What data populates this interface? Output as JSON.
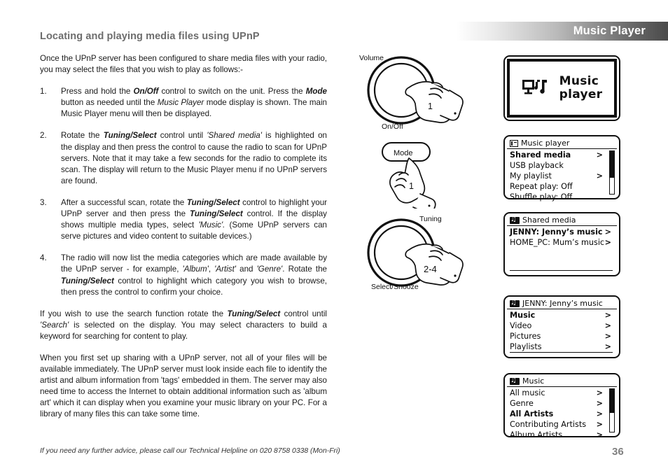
{
  "header": {
    "title": "Music Player"
  },
  "page": {
    "heading": "Locating and playing media files using UPnP",
    "number": "36",
    "footer_note": "If you need any further advice, please call our Technical Helpline on 020 8758 0338 (Mon-Fri)"
  },
  "intro": "Once the UPnP server has been configured to share media files with your radio, you may select the files that you wish to play as follows:-",
  "steps": [
    {
      "num": "1.",
      "text_parts": [
        {
          "t": "Press and hold the ",
          "s": "n"
        },
        {
          "t": "On/Off",
          "s": "bi"
        },
        {
          "t": " control to switch on the unit. Press the ",
          "s": "n"
        },
        {
          "t": "Mode",
          "s": "bi"
        },
        {
          "t": " button as needed until the ",
          "s": "n"
        },
        {
          "t": "Music Player",
          "s": "i"
        },
        {
          "t": " mode display is shown. The main Music Player menu will then be displayed.",
          "s": "n"
        }
      ]
    },
    {
      "num": "2.",
      "text_parts": [
        {
          "t": "Rotate the ",
          "s": "n"
        },
        {
          "t": "Tuning/Select",
          "s": "bi"
        },
        {
          "t": " control until ",
          "s": "n"
        },
        {
          "t": "'Shared media'",
          "s": "i"
        },
        {
          "t": " is highlighted on the display and then press the control to cause the radio to scan for UPnP servers. Note that it may take a few seconds for the radio to complete its scan. The display will return to the Music Player menu if no UPnP servers are found.",
          "s": "n"
        }
      ]
    },
    {
      "num": "3.",
      "text_parts": [
        {
          "t": "After a successful scan, rotate the ",
          "s": "n"
        },
        {
          "t": "Tuning/Select",
          "s": "bi"
        },
        {
          "t": " control to highlight your UPnP server and then press the ",
          "s": "n"
        },
        {
          "t": "Tuning/Select",
          "s": "bi"
        },
        {
          "t": " control. If the display shows multiple media types, select ",
          "s": "n"
        },
        {
          "t": "'Music'.",
          "s": "i"
        },
        {
          "t": " (Some UPnP servers can serve pictures and video content to suitable devices.)",
          "s": "n"
        }
      ]
    },
    {
      "num": "4.",
      "text_parts": [
        {
          "t": "The radio will now list the media categories which are made available by the UPnP server - for example, ",
          "s": "n"
        },
        {
          "t": "'Album'",
          "s": "i"
        },
        {
          "t": ", ",
          "s": "n"
        },
        {
          "t": "'Artist'",
          "s": "i"
        },
        {
          "t": " and ",
          "s": "n"
        },
        {
          "t": "'Genre'",
          "s": "i"
        },
        {
          "t": ". Rotate the ",
          "s": "n"
        },
        {
          "t": "Tuning/Select",
          "s": "bi"
        },
        {
          "t": " control to highlight which category you wish to browse, then press the control to confirm your choice.",
          "s": "n"
        }
      ]
    }
  ],
  "search_para": {
    "text_parts": [
      {
        "t": "If you wish to use the search function rotate the ",
        "s": "n"
      },
      {
        "t": "Tuning/Select",
        "s": "bi"
      },
      {
        "t": " control until ",
        "s": "n"
      },
      {
        "t": "'Search'",
        "s": "i"
      },
      {
        "t": " is selected on the display. You may select characters to build a keyword for searching for content to play.",
        "s": "n"
      }
    ]
  },
  "closing": "When you first set up sharing with a UPnP server, not all of your files will be available immediately. The UPnP server must look inside each file to identify the artist and album information from 'tags' embedded in them. The server  may also need time to access the Internet to obtain additional information such as 'album art' which it can display when you examine your music library on your PC. For a library of many files this can take some time.",
  "diagrams": [
    {
      "id": "volume-onoff-knob",
      "icon": "rotary-knob-icon",
      "top_label": "Volume",
      "bottom_label": "On/Off",
      "step_number": "1"
    },
    {
      "id": "mode-button",
      "icon": "mode-button-icon",
      "button_label": "Mode",
      "step_number": "1"
    },
    {
      "id": "tuning-select-knob",
      "icon": "rotary-knob-icon",
      "top_label": "Tuning",
      "bottom_label": "Select/Snooze",
      "step_number": "2-4"
    }
  ],
  "displays": {
    "splash": {
      "icon": "pc-music-note-icon",
      "line1": "Music",
      "line2": "player"
    },
    "menu1": {
      "icon": "list-menu-icon",
      "title": "Music player",
      "rows": [
        {
          "label": "Shared media",
          "chevron": ">",
          "selected": true
        },
        {
          "label": "USB playback",
          "chevron": "",
          "selected": false
        },
        {
          "label": "My playlist",
          "chevron": ">",
          "selected": false
        },
        {
          "label": "Repeat play: Off",
          "chevron": "",
          "selected": false
        },
        {
          "label": "Shuffle play: Off",
          "chevron": "",
          "selected": false
        }
      ],
      "scrollbar": {
        "thumb_top_pct": 0,
        "thumb_height_pct": 62
      }
    },
    "menu2": {
      "icon": "shared-media-icon",
      "title": "Shared media",
      "rows": [
        {
          "label": "JENNY: Jenny’s music",
          "chevron": ">",
          "selected": true
        },
        {
          "label": "HOME_PC: Mum’s music",
          "chevron": ">",
          "selected": false
        }
      ],
      "scrollbar": null
    },
    "menu3": {
      "icon": "shared-media-icon",
      "title": "JENNY: Jenny’s music",
      "rows": [
        {
          "label": "Music",
          "chevron": ">",
          "selected": true
        },
        {
          "label": "Video",
          "chevron": ">",
          "selected": false
        },
        {
          "label": "Pictures",
          "chevron": ">",
          "selected": false
        },
        {
          "label": "Playlists",
          "chevron": ">",
          "selected": false
        }
      ],
      "scrollbar": null
    },
    "menu4": {
      "icon": "shared-media-icon",
      "title": "Music",
      "rows": [
        {
          "label": "All music",
          "chevron": ">",
          "selected": false
        },
        {
          "label": "Genre",
          "chevron": ">",
          "selected": false
        },
        {
          "label": "All Artists",
          "chevron": ">",
          "selected": true
        },
        {
          "label": "Contributing Artists",
          "chevron": ">",
          "selected": false
        },
        {
          "label": "Album Artists",
          "chevron": ">",
          "selected": false
        }
      ],
      "scrollbar": {
        "thumb_top_pct": 0,
        "thumb_height_pct": 55
      }
    }
  }
}
